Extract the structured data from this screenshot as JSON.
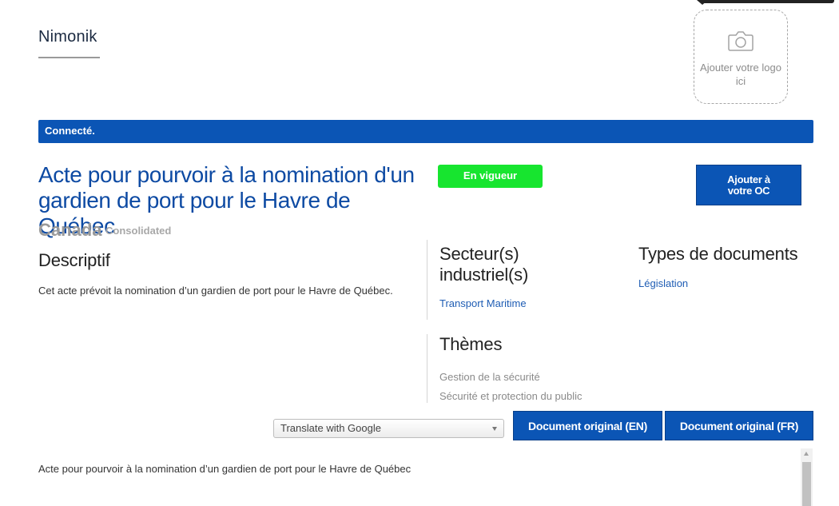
{
  "header": {
    "brand": "Nimonik",
    "logo_placeholder": {
      "icon": "camera-icon",
      "text": "Ajouter votre logo ici"
    }
  },
  "status_bar": {
    "text": "Connecté.",
    "color": "#0b55b5"
  },
  "document": {
    "title": "Acte pour pourvoir à la nomination d'un gardien de port pour le Havre de Québec",
    "status_badge": {
      "text": "En vigueur",
      "color": "#17e52f"
    },
    "add_button": "Ajouter à votre OC",
    "jurisdiction": "Canada",
    "consolidation": "Consolidated"
  },
  "descriptif": {
    "heading": "Descriptif",
    "text": "Cet acte prévoit la nomination d’un gardien de port pour le Havre de Québec."
  },
  "secteurs": {
    "heading": "Secteur(s) industriel(s)",
    "items": [
      "Transport Maritime"
    ]
  },
  "types": {
    "heading": "Types de documents",
    "items": [
      "Législation"
    ]
  },
  "themes": {
    "heading": "Thèmes",
    "items": [
      "Gestion de la sécurité",
      "Sécurité et protection du public"
    ]
  },
  "toolbar": {
    "translate_label": "Translate with Google",
    "original_en": "Document original (EN)",
    "original_fr": "Document original (FR)"
  },
  "content": {
    "body_first_line": "Acte pour pourvoir à la nomination d’un gardien de port pour le Havre de Québec"
  },
  "colors": {
    "brand_blue": "#0b55b5",
    "title_blue": "#0d4aa3",
    "link_blue": "#1f5db4"
  }
}
